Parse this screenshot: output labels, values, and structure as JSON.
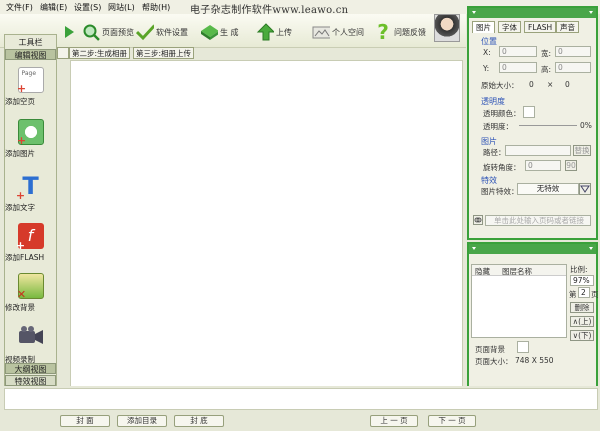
{
  "menu": [
    "文件(F)",
    "编辑(E)",
    "设置(S)",
    "网站(L)",
    "帮助(H)"
  ],
  "title_text": "电子杂志制作软件www.leawo.cn",
  "toolbar": {
    "page_preview": "页面预览",
    "software_settings": "软件设置",
    "generate": "生 成",
    "upload": "上传",
    "personal_space": "个人空间",
    "feedback": "问题反馈"
  },
  "left_panel": {
    "toolbar_title": "工具栏",
    "edit_view": "编辑视图",
    "tools": [
      "添加空页",
      "添加图片",
      "添加文字",
      "添加FLASH",
      "修改背景",
      "视频录制"
    ],
    "outline_view": "大纲视图",
    "effect_view": "特效视图"
  },
  "step_tabs": [
    "第二步:生成相册",
    "第三步:相册上传"
  ],
  "props": {
    "tabs": [
      "图片",
      "字体",
      "FLASH",
      "声音"
    ],
    "position_title": "位置",
    "x_label": "X:",
    "y_label": "Y:",
    "w_label": "宽:",
    "h_label": "高:",
    "x": "0",
    "y": "0",
    "w": "0",
    "h": "0",
    "orig_size_label": "原始大小：",
    "orig_w": "0",
    "orig_x": "×",
    "orig_h": "0",
    "transparency_title": "透明度",
    "transparent_color_label": "透明颜色：",
    "transparency_label": "透明度：",
    "transparency_value": "0%",
    "image_title": "图片",
    "path_label": "路径：",
    "replace_button": "替换",
    "rotation_label": "旋转角度：",
    "rotation_value": "0",
    "rotation_button": "90",
    "effect_title": "特效",
    "image_effect_label": "图片特效：",
    "image_effect_value": "无特效",
    "link_placeholder": "单击此处输入页码或者链接"
  },
  "pages": {
    "col_hide": "隐藏",
    "col_name": "图层名称",
    "ratio_label": "比例:",
    "ratio_value": "97%",
    "page_prefix": "第",
    "page_num": "2",
    "page_suffix": "页",
    "delete": "删除",
    "up": "∧(上)",
    "down": "∨(下)",
    "bg_label": "页面背景",
    "size_label": "页面大小：",
    "size_value": "748 X 550"
  },
  "bottom": [
    "封 面",
    "添加目录",
    "封 底",
    "上 一 页",
    "下 一 页"
  ],
  "colors": {
    "accent_green": "#3aa13a",
    "section_blue": "#2c52b6"
  }
}
